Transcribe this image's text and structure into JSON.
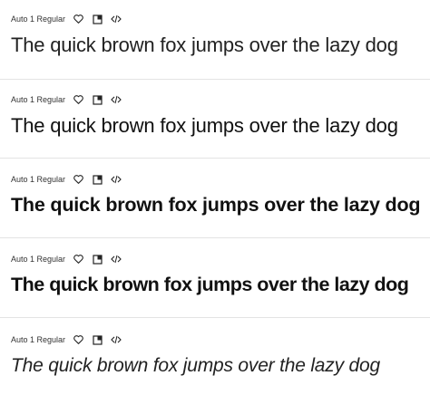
{
  "rows": [
    {
      "font_name": "Auto 1 Regular",
      "sample": "The quick brown fox jumps over the lazy dog",
      "icons": [
        "heart-icon",
        "bookmark-icon",
        "code-icon"
      ]
    },
    {
      "font_name": "Auto 1 Regular",
      "sample": "The quick brown fox jumps over the lazy dog",
      "icons": [
        "heart-icon",
        "bookmark-icon",
        "code-icon"
      ]
    },
    {
      "font_name": "Auto 1 Regular",
      "sample": "The quick brown fox jumps over the lazy dog",
      "icons": [
        "heart-icon",
        "bookmark-icon",
        "code-icon"
      ]
    },
    {
      "font_name": "Auto 1 Regular",
      "sample": "The quick brown fox jumps over the lazy dog",
      "icons": [
        "heart-icon",
        "bookmark-icon",
        "code-icon"
      ]
    },
    {
      "font_name": "Auto 1 Regular",
      "sample": "The quick brown fox jumps over the lazy dog",
      "icons": [
        "heart-icon",
        "bookmark-icon",
        "code-icon"
      ]
    }
  ],
  "colors": {
    "text": "#111111",
    "divider": "#e3e3e3",
    "meta_text": "#333333"
  }
}
